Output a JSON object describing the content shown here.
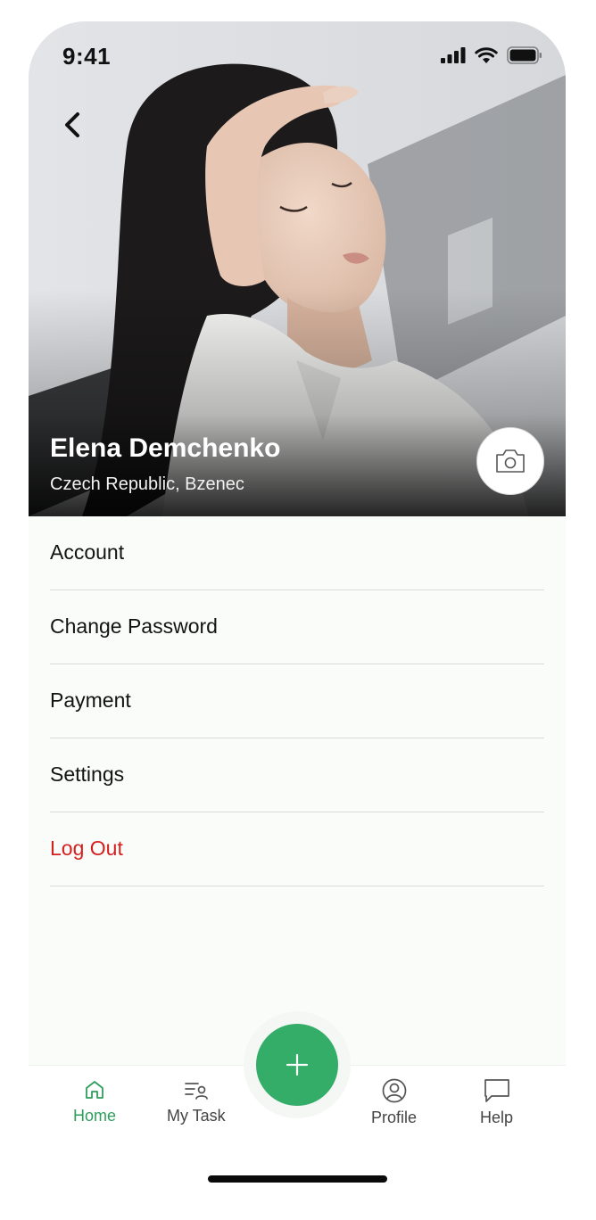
{
  "status_bar": {
    "time": "9:41"
  },
  "profile": {
    "name": "Elena Demchenko",
    "location": "Czech Republic, Bzenec"
  },
  "menu": {
    "items": [
      {
        "label": "Account"
      },
      {
        "label": "Change Password"
      },
      {
        "label": "Payment"
      },
      {
        "label": "Settings"
      },
      {
        "label": "Log Out"
      }
    ]
  },
  "tabbar": {
    "tabs": [
      {
        "label": "Home",
        "icon": "home-icon",
        "active": true
      },
      {
        "label": "My Task",
        "icon": "task-list-icon",
        "active": false
      },
      {
        "label": "Profile",
        "icon": "user-circle-icon",
        "active": false
      },
      {
        "label": "Help",
        "icon": "chat-bubble-icon",
        "active": false
      }
    ],
    "fab_icon": "plus-icon"
  },
  "colors": {
    "accent": "#33ad68",
    "active_tab": "#2f9e5b",
    "danger": "#d41f1f",
    "background": "#fafcfa"
  }
}
